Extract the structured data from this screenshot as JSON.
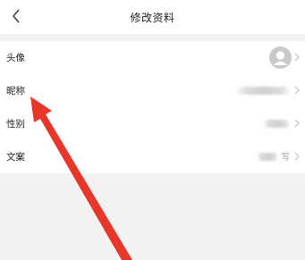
{
  "header": {
    "title": "修改资料",
    "back_icon": "chevron-left-icon"
  },
  "profile": {
    "rows": [
      {
        "label": "头像",
        "value": ""
      },
      {
        "label": "昵称",
        "value": ""
      },
      {
        "label": "性别",
        "value": ""
      },
      {
        "label": "文案",
        "value": "写"
      }
    ]
  },
  "annotation": {
    "color": "#e8362a"
  }
}
